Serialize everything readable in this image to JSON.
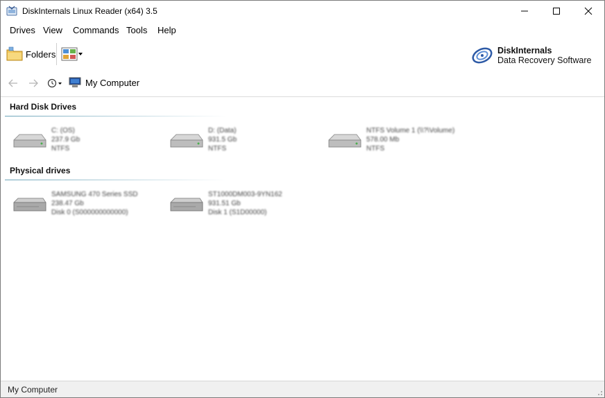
{
  "window": {
    "title": "DiskInternals Linux Reader (x64) 3.5"
  },
  "menu": [
    "Drives",
    "View",
    "Commands",
    "Tools",
    "Help"
  ],
  "toolbar": {
    "folders_label": "Folders",
    "brand_line1": "DiskInternals",
    "brand_line2": "Data Recovery Software"
  },
  "address": {
    "location": "My Computer"
  },
  "sections": {
    "hard_disk_drives": {
      "title": "Hard Disk Drives",
      "items": [
        {
          "line1": "C: (OS)",
          "line2": "237.9 Gb",
          "line3": "NTFS"
        },
        {
          "line1": "D: (Data)",
          "line2": "931.5 Gb",
          "line3": "NTFS"
        },
        {
          "line1": "NTFS Volume 1 (\\\\?\\Volume)",
          "line2": "578.00 Mb",
          "line3": "NTFS"
        }
      ]
    },
    "physical_drives": {
      "title": "Physical drives",
      "items": [
        {
          "line1": "SAMSUNG 470 Series SSD",
          "line2": "238.47 Gb",
          "line3": "Disk 0 (S000000000000)"
        },
        {
          "line1": "ST1000DM003-9YN162",
          "line2": "931.51 Gb",
          "line3": "Disk 1 (S1D00000)"
        }
      ]
    }
  },
  "status": {
    "text": "My Computer"
  }
}
